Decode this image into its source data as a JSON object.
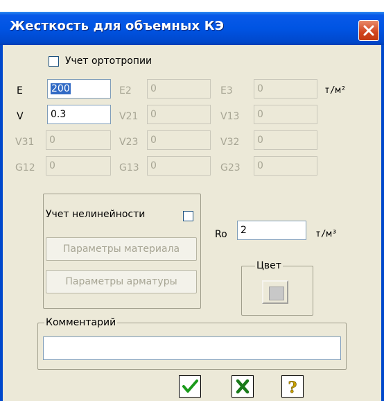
{
  "window": {
    "title": "Жесткость для объемных КЭ"
  },
  "orthotropy": {
    "label": "Учет ортотропии",
    "checked": false
  },
  "fields": {
    "E": {
      "label": "E",
      "value": "200",
      "enabled": true
    },
    "E2": {
      "label": "E2",
      "value": "0",
      "enabled": false
    },
    "E3": {
      "label": "E3",
      "value": "0",
      "enabled": false
    },
    "V": {
      "label": "V",
      "value": "0.3",
      "enabled": true
    },
    "V21": {
      "label": "V21",
      "value": "0",
      "enabled": false
    },
    "V13": {
      "label": "V13",
      "value": "0",
      "enabled": false
    },
    "V31": {
      "label": "V31",
      "value": "0",
      "enabled": false
    },
    "V23": {
      "label": "V23",
      "value": "0",
      "enabled": false
    },
    "V32": {
      "label": "V32",
      "value": "0",
      "enabled": false
    },
    "G12": {
      "label": "G12",
      "value": "0",
      "enabled": false
    },
    "G13": {
      "label": "G13",
      "value": "0",
      "enabled": false
    },
    "G23": {
      "label": "G23",
      "value": "0",
      "enabled": false
    }
  },
  "units": {
    "modulus": "т/м²",
    "density": "т/м³"
  },
  "nonlinearity": {
    "label": "Учет нелинейности",
    "checked": false,
    "material_button": "Параметры материала",
    "rebar_button": "Параметры арматуры"
  },
  "density": {
    "label": "Ro",
    "value": "2"
  },
  "color_group": {
    "title": "Цвет",
    "swatch_color": "#c8c8c8"
  },
  "comment": {
    "title": "Комментарий",
    "value": ""
  },
  "buttons": {
    "ok": {
      "icon": "checkmark-icon",
      "color": "#1a9a1a"
    },
    "cancel": {
      "icon": "x-icon",
      "color": "#1a7a1a"
    },
    "help": {
      "icon": "question-icon",
      "color": "#c8a000"
    }
  },
  "colors": {
    "title_bar": "#0054e3",
    "dialog_bg": "#ece9d8",
    "close_button": "#d1441e"
  }
}
